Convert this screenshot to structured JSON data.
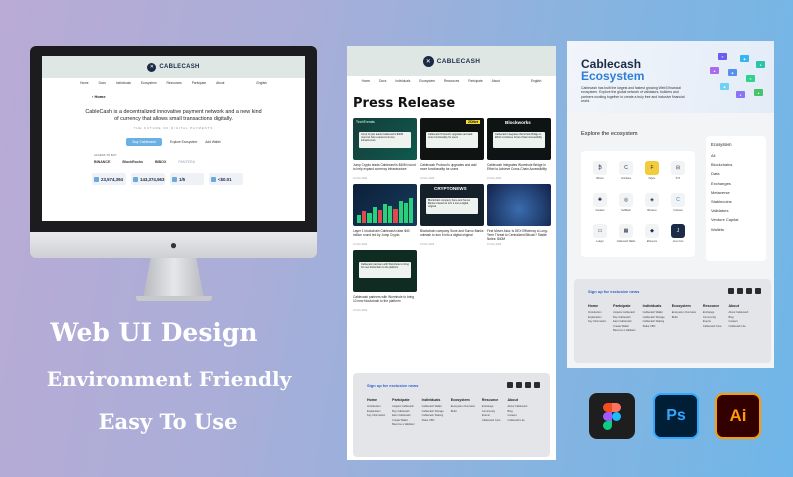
{
  "brand": {
    "name": "CABLECASH",
    "logo_glyph": "✕"
  },
  "nav": [
    "Home",
    "Docs",
    "Individuals",
    "Ecosystem",
    "Resources",
    "Partcipate",
    "About"
  ],
  "lang": "English",
  "landing": {
    "breadcrumb": "‹ Home",
    "hero": "CableCash is a decentralized innovative payment network and a new kind of currency that allows small transactions digitally.",
    "tagline": "THE FUTURE OF DIGITAL PAYMENTS",
    "buy_button": "Buy Cablecash",
    "explore_link": "Explore Ecosystem",
    "wallet_link": "Add Wallet",
    "access_label": "ACCESS TO BUY",
    "partners": [
      "BINANCE",
      "BlockRocks",
      "BIBOX",
      "PANTERA"
    ],
    "stats": [
      "23,574,394",
      "143,374,563",
      "1/5",
      "<$0.01"
    ]
  },
  "press": {
    "title": "Press Release",
    "cards": [
      {
        "brand": "TechTrends",
        "headline": "Jump Crypto leads Cablecash's $40M round to help expand currency infrastructure",
        "date": "21 Nov 2022"
      },
      {
        "brand": "ZDNet",
        "headline": "Cablecash Protocol's upgrades and add more functionality for users",
        "date": "21 Nov 2022"
      },
      {
        "brand": "Blockworks",
        "headline": "Cablecash Integrates Wormhole Bridge in Effort to Achieve Cross-Chain Accessibility",
        "date": "21 Nov 2022"
      },
      {
        "brand": "",
        "headline": "Layer 1 blockchain Cablecash raise $40 million round led by Jump Crypto",
        "date": "21 Nov 2022"
      },
      {
        "brand": "CRYPTONEWS",
        "headline": "Blockchain company Sune and Sunvo Banks unleash to turn it into a digital original",
        "date": "21 Nov 2022"
      },
      {
        "brand": "",
        "headline": "First Mover Asia: Is DEX Efficiency a Long-Term Threat to Centralized Bitcoin? Stable Notes: $40M",
        "date": "21 Nov 2022"
      },
      {
        "brand": "",
        "headline": "Cablecash partners with Wormhole to bring 10 new blockchain to the platform",
        "date": "21 Nov 2022"
      }
    ]
  },
  "footer": {
    "signup": "Sign up for exclusive news",
    "cols_mid": [
      {
        "head": "Home",
        "items": [
          "Introduction",
          "Explanation",
          "Key Information"
        ]
      },
      {
        "head": "Partcipate",
        "items": [
          "Acquire Cablecash",
          "Buy Cablecash",
          "Earn Cablecash",
          "Create Wallet",
          "Become a Validator"
        ]
      },
      {
        "head": "Individuals",
        "items": [
          "Cablecash Wallet",
          "Cablecash Storage",
          "Cablecash Staking",
          "Stake CBC"
        ]
      },
      {
        "head": "Ecosystem",
        "items": [
          "Ecosystem Overview",
          "Build"
        ]
      },
      {
        "head": "Resource",
        "items": [
          "Exchange",
          "Community",
          "Events",
          "Cablecash Core"
        ]
      },
      {
        "head": "About",
        "items": [
          "About Cablecash",
          "Blog",
          "Careers",
          "Cablecash Lite"
        ]
      }
    ]
  },
  "ecosystem": {
    "title1": "Cablecash",
    "title2": "Ecosystem",
    "desc": "Cablecash has built the largest and fastest growing Web3 financial ecosystem. Explore the global network of validators, builders and partners working together to create a truly free and inclusive financial world.",
    "explore": "Explore the ecosystem",
    "items": [
      "Bitcoin",
      "Coinbase",
      "Figure",
      "FTX",
      "Cardano",
      "SubBank",
      "Bitnance",
      "Coinweb",
      "Ledger",
      "Cablecash Wallet",
      "Ethereum",
      "Juno Coin"
    ],
    "list_head": "Ecosystem",
    "list": [
      "All",
      "Blockchains",
      "Data",
      "Exchanges",
      "Metaverse",
      "Stablecoins",
      "Validators",
      "Venture Capital",
      "Wallets"
    ]
  },
  "headlines": [
    "Web UI Design",
    "Environment Friendly",
    "Easy To Use"
  ],
  "tools": {
    "ps": "Ps",
    "ai": "Ai"
  },
  "colors": {
    "accent": "#2d7fd6",
    "brand_dark": "#1b2a47",
    "buy_button": "#6bb0e3"
  }
}
